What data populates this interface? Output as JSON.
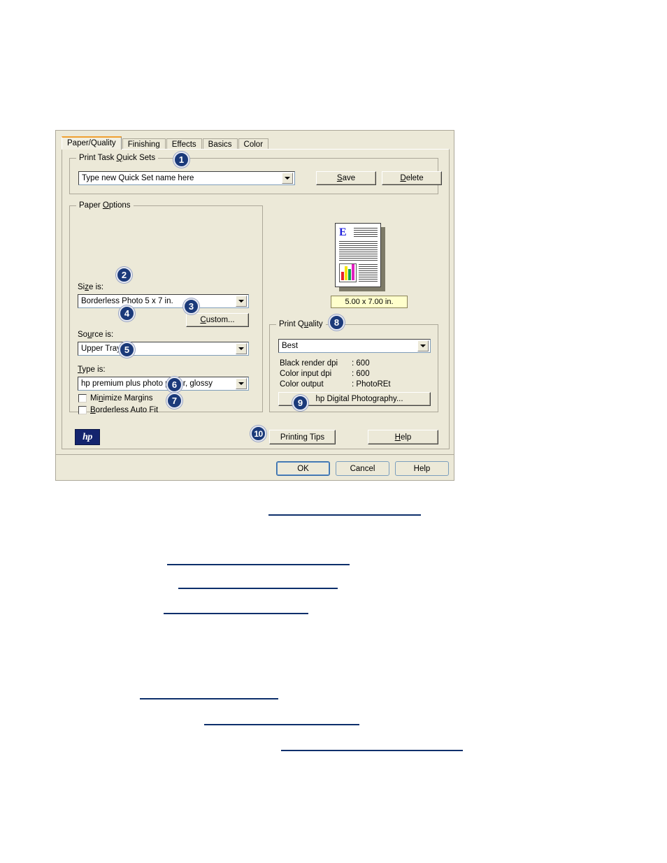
{
  "dialog": {
    "tabs": [
      {
        "label": "Paper/Quality",
        "active": true
      },
      {
        "label": "Finishing",
        "active": false
      },
      {
        "label": "Effects",
        "active": false
      },
      {
        "label": "Basics",
        "active": false
      },
      {
        "label": "Color",
        "active": false
      }
    ],
    "quick_sets": {
      "group_title": "Print Task Quick Sets",
      "value": "Type new Quick Set name here",
      "save_label": "Save",
      "delete_label": "Delete"
    },
    "paper_options": {
      "group_title": "Paper Options",
      "size_label": "Size is:",
      "size_value": "Borderless Photo 5 x 7 in.",
      "custom_label": "Custom...",
      "source_label": "Source is:",
      "source_value": "Upper Tray",
      "type_label": "Type is:",
      "type_value": "hp premium plus photo paper, glossy",
      "minimize_margins_label": "Minimize Margins",
      "minimize_margins_checked": false,
      "borderless_auto_fit_label": "Borderless Auto Fit",
      "borderless_auto_fit_checked": false
    },
    "preview": {
      "size_badge": "5.00 x 7.00 in.",
      "page_letter": "E"
    },
    "print_quality": {
      "group_title": "Print Quality",
      "value": "Best",
      "stats": [
        {
          "label": "Black render dpi",
          "sep": ":",
          "value": "600"
        },
        {
          "label": "Color input dpi",
          "sep": ":",
          "value": "600"
        },
        {
          "label": "Color output",
          "sep": ":",
          "value": "PhotoREt"
        }
      ],
      "digital_photography_label": "hp Digital Photography..."
    },
    "brand": {
      "logo_text": "hp"
    },
    "tips_bar": {
      "printing_tips_label": "Printing Tips",
      "help_label": "Help"
    },
    "footer": {
      "ok_label": "OK",
      "cancel_label": "Cancel",
      "help_label": "Help"
    },
    "callouts": [
      {
        "n": "1"
      },
      {
        "n": "2"
      },
      {
        "n": "3"
      },
      {
        "n": "4"
      },
      {
        "n": "5"
      },
      {
        "n": "6"
      },
      {
        "n": "7"
      },
      {
        "n": "8"
      },
      {
        "n": "9"
      },
      {
        "n": "10"
      }
    ]
  },
  "page_links": [
    {
      "id": "link-1",
      "text": ""
    },
    {
      "id": "link-2",
      "text": ""
    },
    {
      "id": "link-3",
      "text": ""
    },
    {
      "id": "link-4",
      "text": ""
    },
    {
      "id": "link-5",
      "text": ""
    },
    {
      "id": "link-6",
      "text": ""
    },
    {
      "id": "link-7",
      "text": ""
    }
  ],
  "colors": {
    "dialog_face": "#ece9d8",
    "active_tab_accent": "#f0a030",
    "callout_navy": "#1b3a7a",
    "link_navy": "#0d2f6b",
    "badge_yellow": "#ffffcc",
    "hp_blue": "#14246e"
  }
}
